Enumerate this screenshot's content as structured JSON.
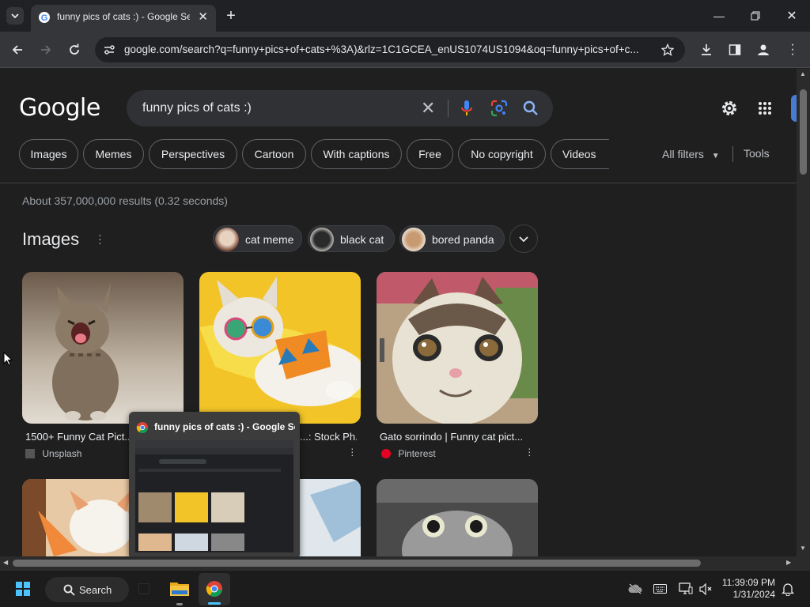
{
  "browser": {
    "tab_title": "funny pics of cats :) - Google Se...",
    "url": "google.com/search?q=funny+pics+of+cats+%3A)&rlz=1C1GCEA_enUS1074US1094&oq=funny+pics+of+c..."
  },
  "search": {
    "logo": "Google",
    "query": "funny pics of cats :)"
  },
  "filters": [
    "Images",
    "Memes",
    "Perspectives",
    "Cartoon",
    "With captions",
    "Free",
    "No copyright",
    "Videos"
  ],
  "all_filters": "All filters",
  "tools": "Tools",
  "results_stats": "About 357,000,000 results (0.32 seconds)",
  "images": {
    "heading": "Images",
    "related": [
      "cat meme",
      "black cat",
      "bored panda"
    ],
    "results": [
      {
        "caption": "1500+ Funny Cat Pict...",
        "source": "Unsplash"
      },
      {
        "caption": "...: Stock Ph...",
        "source": ""
      },
      {
        "caption": "Gato sorrindo | Funny cat pict...",
        "source": "Pinterest"
      }
    ]
  },
  "preview": {
    "title": "funny pics of cats :) - Google Se..."
  },
  "taskbar": {
    "search_label": "Search",
    "time": "11:39:09 PM",
    "date": "1/31/2024"
  }
}
